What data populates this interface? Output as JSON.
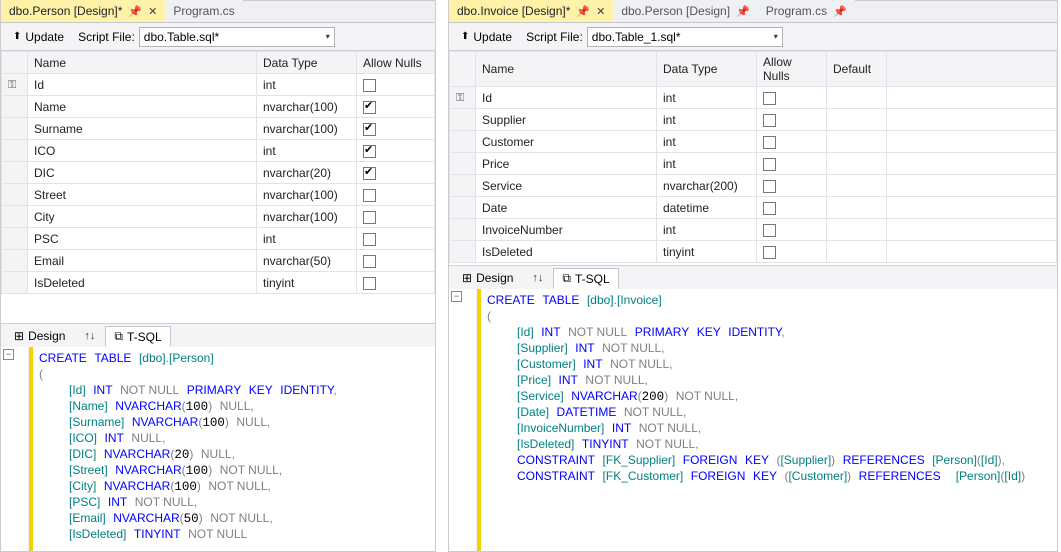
{
  "left": {
    "tabs": [
      {
        "label": "dbo.Person [Design]*",
        "active": true,
        "pinned": true,
        "closeable": true
      },
      {
        "label": "Program.cs",
        "active": false,
        "pinned": false,
        "closeable": false
      }
    ],
    "update_label": "Update",
    "scriptfile_label": "Script File:",
    "scriptfile_value": "dbo.Table.sql*",
    "headers": {
      "name": "Name",
      "datatype": "Data Type",
      "allownulls": "Allow Nulls"
    },
    "rows": [
      {
        "key": true,
        "name": "Id",
        "type": "int",
        "nulls": false
      },
      {
        "key": false,
        "name": "Name",
        "type": "nvarchar(100)",
        "nulls": true
      },
      {
        "key": false,
        "name": "Surname",
        "type": "nvarchar(100)",
        "nulls": true
      },
      {
        "key": false,
        "name": "ICO",
        "type": "int",
        "nulls": true
      },
      {
        "key": false,
        "name": "DIC",
        "type": "nvarchar(20)",
        "nulls": true
      },
      {
        "key": false,
        "name": "Street",
        "type": "nvarchar(100)",
        "nulls": false
      },
      {
        "key": false,
        "name": "City",
        "type": "nvarchar(100)",
        "nulls": false
      },
      {
        "key": false,
        "name": "PSC",
        "type": "int",
        "nulls": false
      },
      {
        "key": false,
        "name": "Email",
        "type": "nvarchar(50)",
        "nulls": false
      },
      {
        "key": false,
        "name": "IsDeleted",
        "type": "tinyint",
        "nulls": false
      }
    ],
    "btabs": {
      "design_icon": "⊞",
      "design": "Design",
      "swap": "↑↓",
      "tsql_icon": "⧉",
      "tsql": "T-SQL"
    },
    "sql_html": "<span class='kw'>CREATE</span> <span class='kw'>TABLE</span> <span class='ident'>[dbo]</span><span class='gray'>.</span><span class='ident'>[Person]</span>\n<span class='gray'>(</span>\n    <span class='ident'>[Id]</span> <span class='kw'>INT</span> <span class='gray'>NOT NULL</span> <span class='kw'>PRIMARY</span> <span class='kw'>KEY</span> <span class='kw'>IDENTITY</span><span class='gray'>,</span>\n    <span class='ident'>[Name]</span> <span class='kw'>NVARCHAR</span><span class='gray'>(</span>100<span class='gray'>)</span> <span class='gray'>NULL,</span>\n    <span class='ident'>[Surname]</span> <span class='kw'>NVARCHAR</span><span class='gray'>(</span>100<span class='gray'>)</span> <span class='gray'>NULL,</span>\n    <span class='ident'>[ICO]</span> <span class='kw'>INT</span> <span class='gray'>NULL,</span>\n    <span class='ident'>[DIC]</span> <span class='kw'>NVARCHAR</span><span class='gray'>(</span>20<span class='gray'>)</span> <span class='gray'>NULL,</span>\n    <span class='ident'>[Street]</span> <span class='kw'>NVARCHAR</span><span class='gray'>(</span>100<span class='gray'>)</span> <span class='gray'>NOT NULL,</span>\n    <span class='ident'>[City]</span> <span class='kw'>NVARCHAR</span><span class='gray'>(</span>100<span class='gray'>)</span> <span class='gray'>NOT NULL,</span>\n    <span class='ident'>[PSC]</span> <span class='kw'>INT</span> <span class='gray'>NOT NULL,</span>\n    <span class='ident'>[Email]</span> <span class='kw'>NVARCHAR</span><span class='gray'>(</span>50<span class='gray'>)</span> <span class='gray'>NOT NULL,</span>\n    <span class='ident'>[IsDeleted]</span> <span class='kw'>TINYINT</span> <span class='gray'>NOT NULL</span>"
  },
  "right": {
    "tabs": [
      {
        "label": "dbo.Invoice [Design]*",
        "active": true,
        "pinned": true,
        "closeable": true
      },
      {
        "label": "dbo.Person [Design]",
        "active": false,
        "pinned": true,
        "closeable": false
      },
      {
        "label": "Program.cs",
        "active": false,
        "pinned": true,
        "closeable": false
      }
    ],
    "update_label": "Update",
    "scriptfile_label": "Script File:",
    "scriptfile_value": "dbo.Table_1.sql*",
    "headers": {
      "name": "Name",
      "datatype": "Data Type",
      "allownulls": "Allow Nulls",
      "default": "Default"
    },
    "rows": [
      {
        "key": true,
        "name": "Id",
        "type": "int",
        "nulls": false,
        "default": ""
      },
      {
        "key": false,
        "name": "Supplier",
        "type": "int",
        "nulls": false,
        "default": ""
      },
      {
        "key": false,
        "name": "Customer",
        "type": "int",
        "nulls": false,
        "default": ""
      },
      {
        "key": false,
        "name": "Price",
        "type": "int",
        "nulls": false,
        "default": ""
      },
      {
        "key": false,
        "name": "Service",
        "type": "nvarchar(200)",
        "nulls": false,
        "default": ""
      },
      {
        "key": false,
        "name": "Date",
        "type": "datetime",
        "nulls": false,
        "default": ""
      },
      {
        "key": false,
        "name": "InvoiceNumber",
        "type": "int",
        "nulls": false,
        "default": ""
      },
      {
        "key": false,
        "name": "IsDeleted",
        "type": "tinyint",
        "nulls": false,
        "default": ""
      }
    ],
    "btabs": {
      "design_icon": "⊞",
      "design": "Design",
      "swap": "↑↓",
      "tsql_icon": "⧉",
      "tsql": "T-SQL"
    },
    "sql_html": "<span class='kw'>CREATE</span> <span class='kw'>TABLE</span> <span class='ident'>[dbo]</span><span class='gray'>.</span><span class='ident'>[Invoice]</span>\n<span class='gray'>(</span>\n    <span class='ident'>[Id]</span> <span class='kw'>INT</span> <span class='gray'>NOT NULL</span> <span class='kw'>PRIMARY</span> <span class='kw'>KEY</span> <span class='kw'>IDENTITY</span><span class='gray'>,</span>\n    <span class='ident'>[Supplier]</span> <span class='kw'>INT</span> <span class='gray'>NOT NULL,</span>\n    <span class='ident'>[Customer]</span> <span class='kw'>INT</span> <span class='gray'>NOT NULL,</span>\n    <span class='ident'>[Price]</span> <span class='kw'>INT</span> <span class='gray'>NOT NULL,</span>\n    <span class='ident'>[Service]</span> <span class='kw'>NVARCHAR</span><span class='gray'>(</span>200<span class='gray'>)</span> <span class='gray'>NOT NULL,</span>\n    <span class='ident'>[Date]</span> <span class='kw'>DATETIME</span> <span class='gray'>NOT NULL,</span>\n    <span class='ident'>[InvoiceNumber]</span> <span class='kw'>INT</span> <span class='gray'>NOT NULL,</span>\n    <span class='ident'>[IsDeleted]</span> <span class='kw'>TINYINT</span> <span class='gray'>NOT NULL,</span>\n    <span class='kw'>CONSTRAINT</span> <span class='ident'>[FK_Supplier]</span> <span class='kw'>FOREIGN</span> <span class='kw'>KEY</span> <span class='gray'>(</span><span class='ident'>[Supplier]</span><span class='gray'>)</span> <span class='kw'>REFERENCES</span> <span class='ident'>[Person]</span><span class='gray'>(</span><span class='ident'>[Id]</span><span class='gray'>),</span>\n    <span class='kw'>CONSTRAINT</span> <span class='ident'>[FK_Customer]</span> <span class='kw'>FOREIGN</span> <span class='kw'>KEY</span> <span class='gray'>(</span><span class='ident'>[Customer]</span><span class='gray'>)</span> <span class='kw'>REFERENCES</span>  <span class='ident'>[Person]</span><span class='gray'>(</span><span class='ident'>[Id]</span><span class='gray'>)</span>"
  }
}
